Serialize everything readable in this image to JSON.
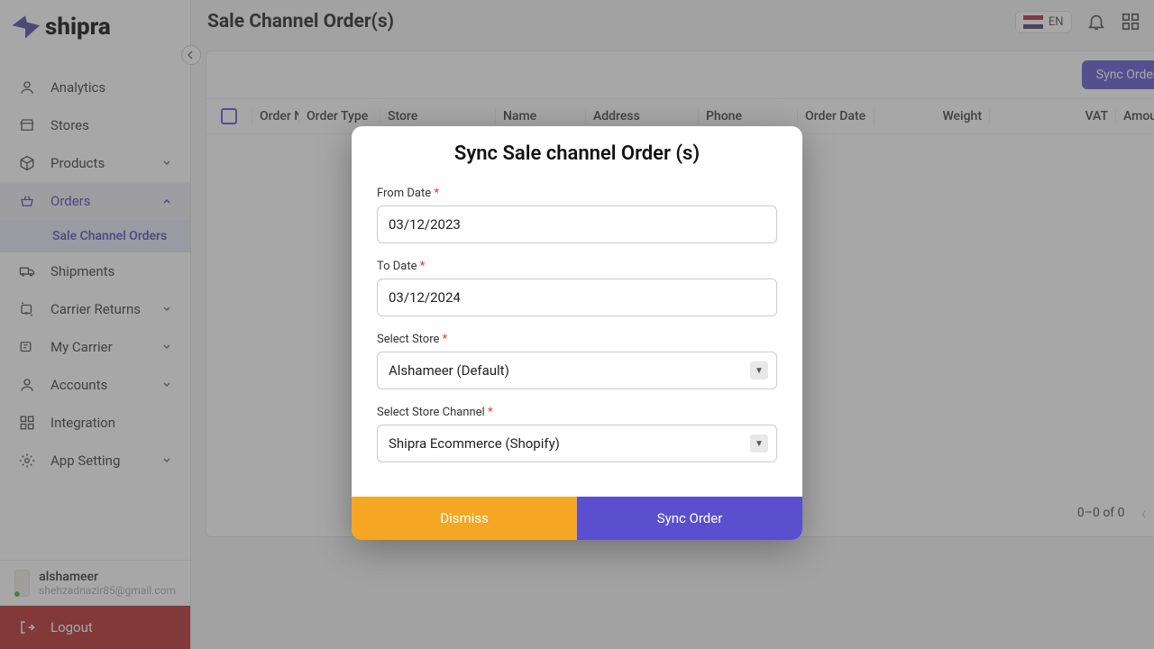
{
  "brand": {
    "name": "shipra"
  },
  "sidebar": {
    "items": [
      {
        "label": "Analytics",
        "icon": "user-icon",
        "expand": false
      },
      {
        "label": "Stores",
        "icon": "store-icon",
        "expand": false
      },
      {
        "label": "Products",
        "icon": "box-icon",
        "expand": true
      },
      {
        "label": "Orders",
        "icon": "basket-icon",
        "expand": true,
        "open": true,
        "active": true
      },
      {
        "label": "Shipments",
        "icon": "truck-icon",
        "expand": false
      },
      {
        "label": "Carrier Returns",
        "icon": "returns-icon",
        "expand": true
      },
      {
        "label": "My Carrier",
        "icon": "carrier-icon",
        "expand": true
      },
      {
        "label": "Accounts",
        "icon": "accounts-icon",
        "expand": true
      },
      {
        "label": "Integration",
        "icon": "integration-icon",
        "expand": false
      },
      {
        "label": "App Setting",
        "icon": "settings-icon",
        "expand": true
      }
    ],
    "sub_order": "Sale Channel Orders"
  },
  "user": {
    "name": "alshameer",
    "email": "shehzadnazir85@gmail.com",
    "logout": "Logout"
  },
  "header": {
    "title": "Sale Channel Order(s)",
    "lang_label": "EN",
    "sync_btn": "Sync Order"
  },
  "table": {
    "cols": [
      "Order No",
      "Order Type",
      "Store",
      "Name",
      "Address",
      "Phone",
      "Order Date",
      "Weight",
      "VAT",
      "Amount"
    ],
    "pagination": "0–0 of 0"
  },
  "modal": {
    "title": "Sync Sale channel Order (s)",
    "from_label": "From Date",
    "from_value": "03/12/2023",
    "to_label": "To Date",
    "to_value": "03/12/2024",
    "store_label": "Select Store",
    "store_value": "Alshameer (Default)",
    "channel_label": "Select Store Channel",
    "channel_value": "Shipra Ecommerce (Shopify)",
    "dismiss": "Dismiss",
    "sync": "Sync Order"
  }
}
